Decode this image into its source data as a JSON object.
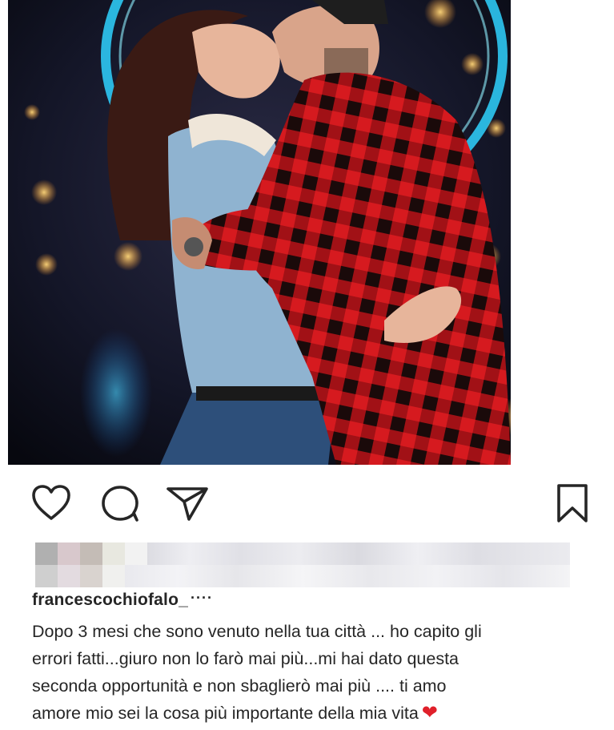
{
  "post": {
    "image_alt": "Couple kissing in front of an illuminated ferris wheel at night",
    "username": "francescochiofalo_",
    "username_suffix": "····",
    "caption_lines": [
      "Dopo 3 mesi che sono venuto nella tua città ... ho capito gli",
      "errori fatti...giuro non lo farò mai più...mi hai dato questa",
      "seconda opportunità e non sbaglierò mai più .... ti amo",
      "amore mio sei la cosa più importante della mia vita"
    ],
    "caption_emoji": "❤"
  },
  "actions": {
    "like": "heart-icon",
    "comment": "comment-icon",
    "share": "send-icon",
    "save": "bookmark-icon"
  },
  "colors": {
    "text": "#262626",
    "emoji_red": "#e0202a",
    "ferris_wheel": "#2fd2ff"
  }
}
